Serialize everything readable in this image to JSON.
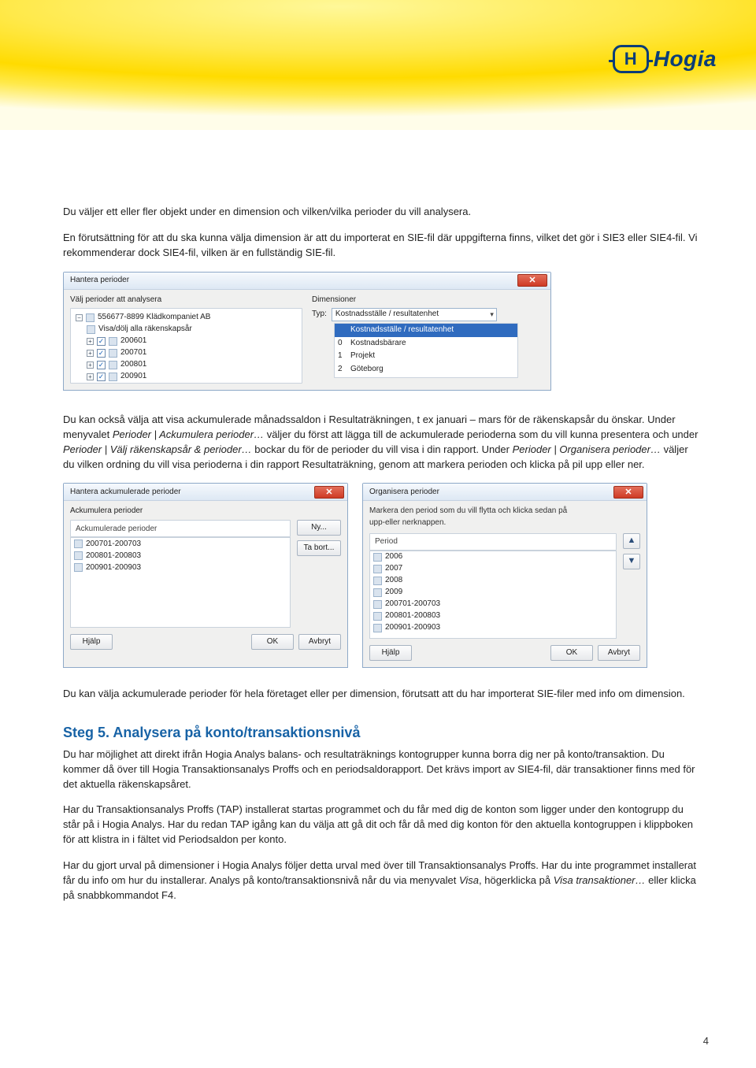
{
  "logo": {
    "mark": "H",
    "brand": "Hogia"
  },
  "intro": {
    "p1": "Du väljer ett eller fler objekt under en dimension och vilken/vilka perioder du vill analysera.",
    "p2a": "En förutsättning för att du ska kunna välja dimension är att du importerat en SIE-fil där uppgifterna finns, vilket det gör i SIE3 eller SIE4-fil. Vi rekommenderar dock SIE4-fil, vilken är en fullständig SIE-fil."
  },
  "dlg_hantera": {
    "title": "Hantera perioder",
    "left_label": "Välj perioder att analysera",
    "right_label": "Dimensioner",
    "tree": {
      "root": "556677-8899 Klädkompaniet AB",
      "toggle": "Visa/dölj alla räkenskapsår",
      "items": [
        "200601",
        "200701",
        "200801",
        "200901"
      ]
    },
    "typ_label": "Typ:",
    "typ_value": "Kostnadsställe / resultatenhet",
    "options": [
      {
        "num": "",
        "label": "Kostnadsställe / resultatenhet",
        "sel": true
      },
      {
        "num": "0",
        "label": "Kostnadsbärare"
      },
      {
        "num": "1",
        "label": "Projekt"
      },
      {
        "num": "2",
        "label": "Göteborg"
      }
    ]
  },
  "mid": {
    "p": "Du kan också välja att visa ackumulerade månadssaldon i Resultaträkningen, t ex januari – mars för de räkenskapsår du önskar. Under menyvalet ",
    "i1": "Perioder | Ackumulera perioder…",
    "p2": " väljer du först att lägga till de ackumulerade perioderna som du vill kunna presentera och under ",
    "i2": "Perioder | Välj räkenskapsår & perioder…",
    "p3": " bockar du för de perioder du vill visa i din rapport. Under ",
    "i3": "Perioder | Organisera perioder…",
    "p4": " väljer du vilken ordning du vill visa perioderna i din rapport Resultaträkning, genom att markera perioden och klicka på pil upp eller ner."
  },
  "dlg_ack": {
    "title": "Hantera ackumulerade perioder",
    "section1": "Ackumulera perioder",
    "section2": "Ackumulerade perioder",
    "items": [
      "200701-200703",
      "200801-200803",
      "200901-200903"
    ],
    "btn_new": "Ny...",
    "btn_del": "Ta bort...",
    "btn_help": "Hjälp",
    "btn_ok": "OK",
    "btn_cancel": "Avbryt"
  },
  "dlg_org": {
    "title": "Organisera perioder",
    "hint": "Markera den period som du vill flytta och klicka sedan på upp-eller nerknappen.",
    "col": "Period",
    "items": [
      "2006",
      "2007",
      "2008",
      "2009",
      "200701-200703",
      "200801-200803",
      "200901-200903"
    ],
    "btn_up": "▲",
    "btn_down": "▼",
    "btn_help": "Hjälp",
    "btn_ok": "OK",
    "btn_cancel": "Avbryt"
  },
  "after_dlgs": "Du kan välja ackumulerade perioder för hela företaget eller per dimension, förutsatt att du har importerat SIE-filer med info om dimension.",
  "step5": {
    "heading": "Steg 5. Analysera på konto/transaktionsnivå",
    "p1": "Du har möjlighet att direkt ifrån Hogia Analys balans- och resultaträknings kontogrupper kunna borra dig ner på konto/transaktion. Du kommer då över till Hogia Transaktionsanalys Proffs och en periodsaldorapport. Det krävs import av SIE4-fil, där transaktioner finns med för det aktuella räkenskapsåret.",
    "p2": "Har du Transaktionsanalys Proffs (TAP) installerat startas programmet och du får med dig de konton som ligger under den kontogrupp du står på i Hogia Analys. Har du redan TAP igång kan du välja att gå dit och får då med dig konton för den aktuella kontogruppen i klippboken för att klistra in i fältet vid Periodsaldon per konto.",
    "p3a": "Har du gjort urval på dimensioner i Hogia Analys följer detta urval med över till Transaktionsanalys Proffs. Har du inte programmet installerat får du info om hur du installerar. Analys på konto/transaktionsnivå når du via menyvalet ",
    "i1": "Visa",
    "p3b": ", högerklicka på ",
    "i2": "Visa transaktioner…",
    "p3c": " eller klicka på snabbkommandot F4."
  },
  "page_number": "4"
}
